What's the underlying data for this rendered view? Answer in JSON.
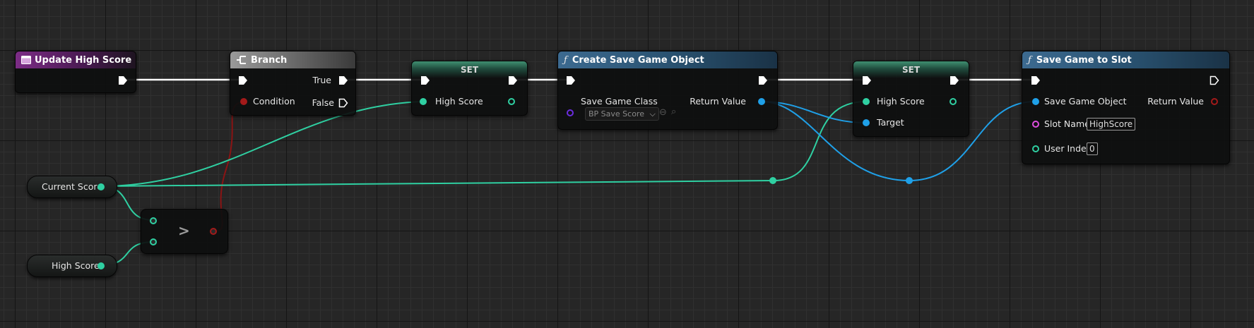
{
  "colors": {
    "exec": "#ffffff",
    "float": "#2fd0a2",
    "bool": "#a31a1a",
    "object": "#1fa0e8",
    "string": "#e04ee0",
    "class": "#6b2de0",
    "event_header": "#7c2c86",
    "function_header": "#3c6a90",
    "set_header": "#3f8f72",
    "branch_header": "#9a9a9a"
  },
  "nodes": {
    "event": {
      "title": "Update High Score",
      "icon": "event-icon"
    },
    "branch": {
      "title": "Branch",
      "icon": "branch-icon",
      "true_label": "True",
      "false_label": "False",
      "condition_label": "Condition"
    },
    "set1": {
      "title": "SET",
      "var_label": "High Score"
    },
    "create_save": {
      "title": "Create Save Game Object",
      "icon": "function-icon",
      "class_label": "Save Game Class",
      "class_value": "BP Save Score",
      "return_label": "Return Value"
    },
    "set2": {
      "title": "SET",
      "var_label": "High Score",
      "target_label": "Target"
    },
    "save_slot": {
      "title": "Save Game to Slot",
      "icon": "function-icon",
      "object_label": "Save Game Object",
      "return_label": "Return Value",
      "slot_label": "Slot Name",
      "slot_value": "HighScore",
      "user_label": "User Index",
      "user_value": "0"
    },
    "compare": {
      "operator": ">"
    }
  },
  "variables": {
    "current_score": "Current Score",
    "high_score": "High Score"
  }
}
